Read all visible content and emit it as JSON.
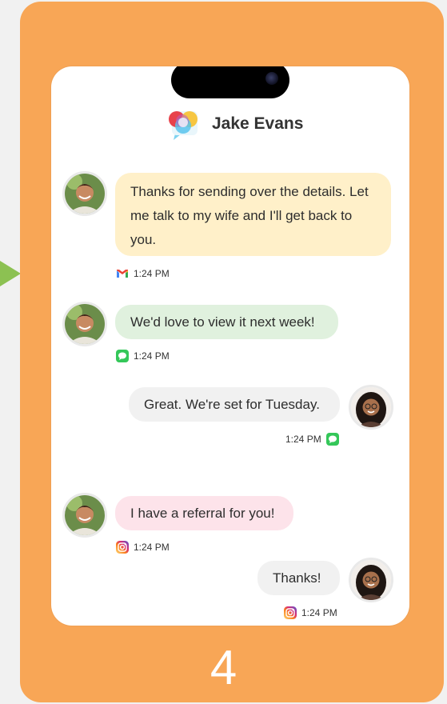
{
  "step": {
    "number": "4"
  },
  "header": {
    "contact_name": "Jake Evans",
    "logo_icon": "chat-hub-logo-icon"
  },
  "messages": [
    {
      "sender": "Jake Evans",
      "side": "left",
      "text": "Thanks for sending over the details. Let me talk to my wife and I'll get back to you.",
      "time": "1:24 PM",
      "service": "gmail",
      "bubble_color": "#fff0c9"
    },
    {
      "sender": "Jake Evans",
      "side": "left",
      "text": "We'd love to view it next week!",
      "time": "1:24 PM",
      "service": "imessage",
      "bubble_color": "#e0f1de"
    },
    {
      "sender": "agent",
      "side": "right",
      "text": "Great. We're set for Tuesday.",
      "time": "1:24 PM",
      "service": "imessage",
      "bubble_color": "#f1f1f1"
    },
    {
      "sender": "Jake Evans",
      "side": "left",
      "text": "I have a referral for you!",
      "time": "1:24 PM",
      "service": "instagram",
      "bubble_color": "#fde3ea"
    },
    {
      "sender": "agent",
      "side": "right",
      "text": "Thanks!",
      "time": "1:24 PM",
      "service": "instagram",
      "bubble_color": "#f1f1f1"
    }
  ],
  "colors": {
    "card": "#f8a656",
    "arrow": "#8cc152",
    "imessage": "#34c759"
  }
}
